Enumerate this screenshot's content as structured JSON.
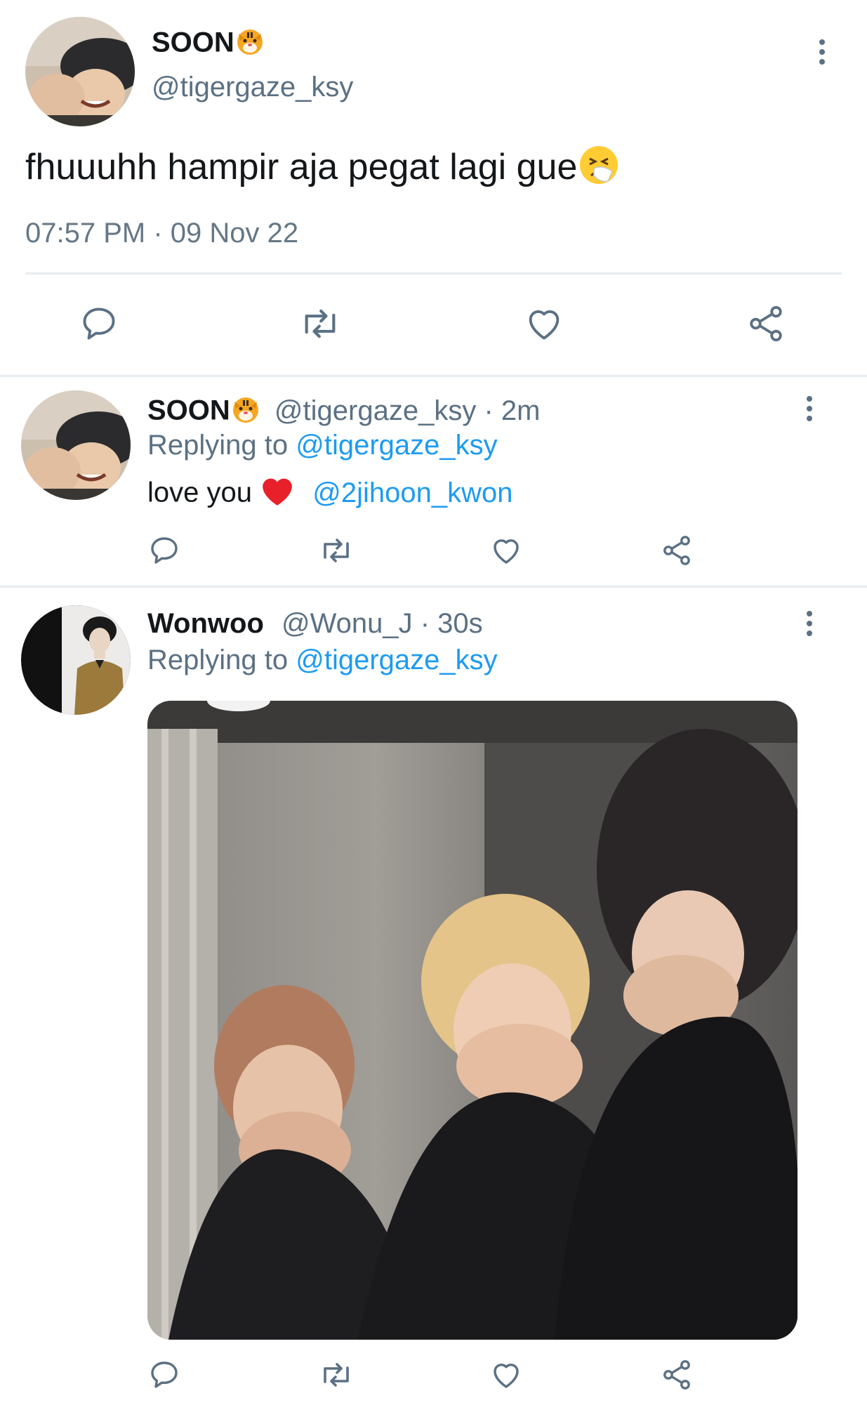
{
  "main_tweet": {
    "display_name": "SOON",
    "handle": "@tigergaze_ksy",
    "text": "fhuuuhh hampir aja pegat lagi gue",
    "timestamp": "07:57 PM · 09 Nov 22",
    "name_emoji": "tiger-face-emoji",
    "text_emoji": "sneezing-face-emoji"
  },
  "reply_1": {
    "display_name": "SOON",
    "handle": "@tigergaze_ksy · 2m",
    "replying_prefix": "Replying to",
    "replying_handle": "@tigergaze_ksy",
    "text": "love you",
    "mention": "@2jihoon_kwon",
    "text_emoji": "red-heart-emoji"
  },
  "reply_2": {
    "display_name": "Wonwoo",
    "handle": "@Wonu_J · 30s",
    "replying_prefix": "Replying to",
    "replying_handle": "@tigergaze_ksy",
    "media": "photo of three people laughing and covering their mouths"
  },
  "colors": {
    "link_blue": "#1d9bf0",
    "muted_gray": "#5b7083",
    "divider": "#e6ecf0"
  },
  "icons": [
    "reply-icon",
    "retweet-icon",
    "like-icon",
    "share-icon",
    "more-options-icon"
  ]
}
